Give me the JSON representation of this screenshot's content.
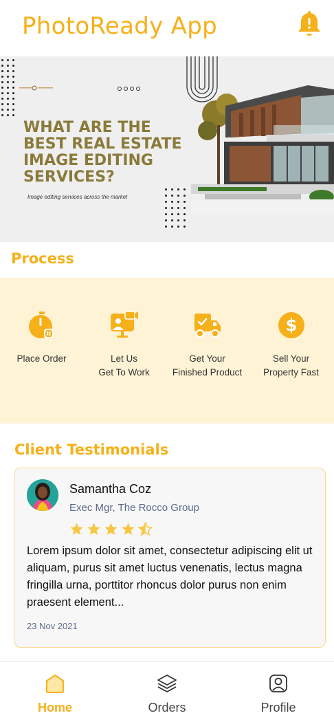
{
  "header": {
    "title": "PhotoReady App",
    "bell_icon": "bell-icon"
  },
  "banner": {
    "heading": "WHAT ARE THE BEST REAL ESTATE IMAGE EDITING SERVICES?",
    "subheading": "Image editing services across the market"
  },
  "process": {
    "title": "Process",
    "steps": [
      {
        "label": "Place Order",
        "icon": "timer-icon"
      },
      {
        "label": "Let Us\nGet To Work",
        "icon": "video-call-icon"
      },
      {
        "label": "Get Your\nFinished Product",
        "icon": "delivery-truck-icon"
      },
      {
        "label": "Sell Your\nProperty Fast",
        "icon": "dollar-icon"
      }
    ]
  },
  "testimonials": {
    "title": "Client Testimonials",
    "card": {
      "name": "Samantha Coz",
      "role": "Exec Mgr, The Rocco Group",
      "rating": 4.5,
      "review": "Lorem ipsum dolor sit amet, consectetur adipiscing elit ut aliquam, purus sit amet luctus venenatis, lectus magna fringilla urna, porttitor rhoncus dolor purus non enim praesent element...",
      "date": "23 Nov 2021"
    }
  },
  "bottom_nav": {
    "items": [
      {
        "label": "Home",
        "icon": "home-icon",
        "active": true
      },
      {
        "label": "Orders",
        "icon": "layers-icon",
        "active": false
      },
      {
        "label": "Profile",
        "icon": "profile-icon",
        "active": false
      }
    ]
  },
  "colors": {
    "accent": "#f5b01a",
    "process_background": "#fff3d6",
    "card_border": "#f7d98a"
  }
}
